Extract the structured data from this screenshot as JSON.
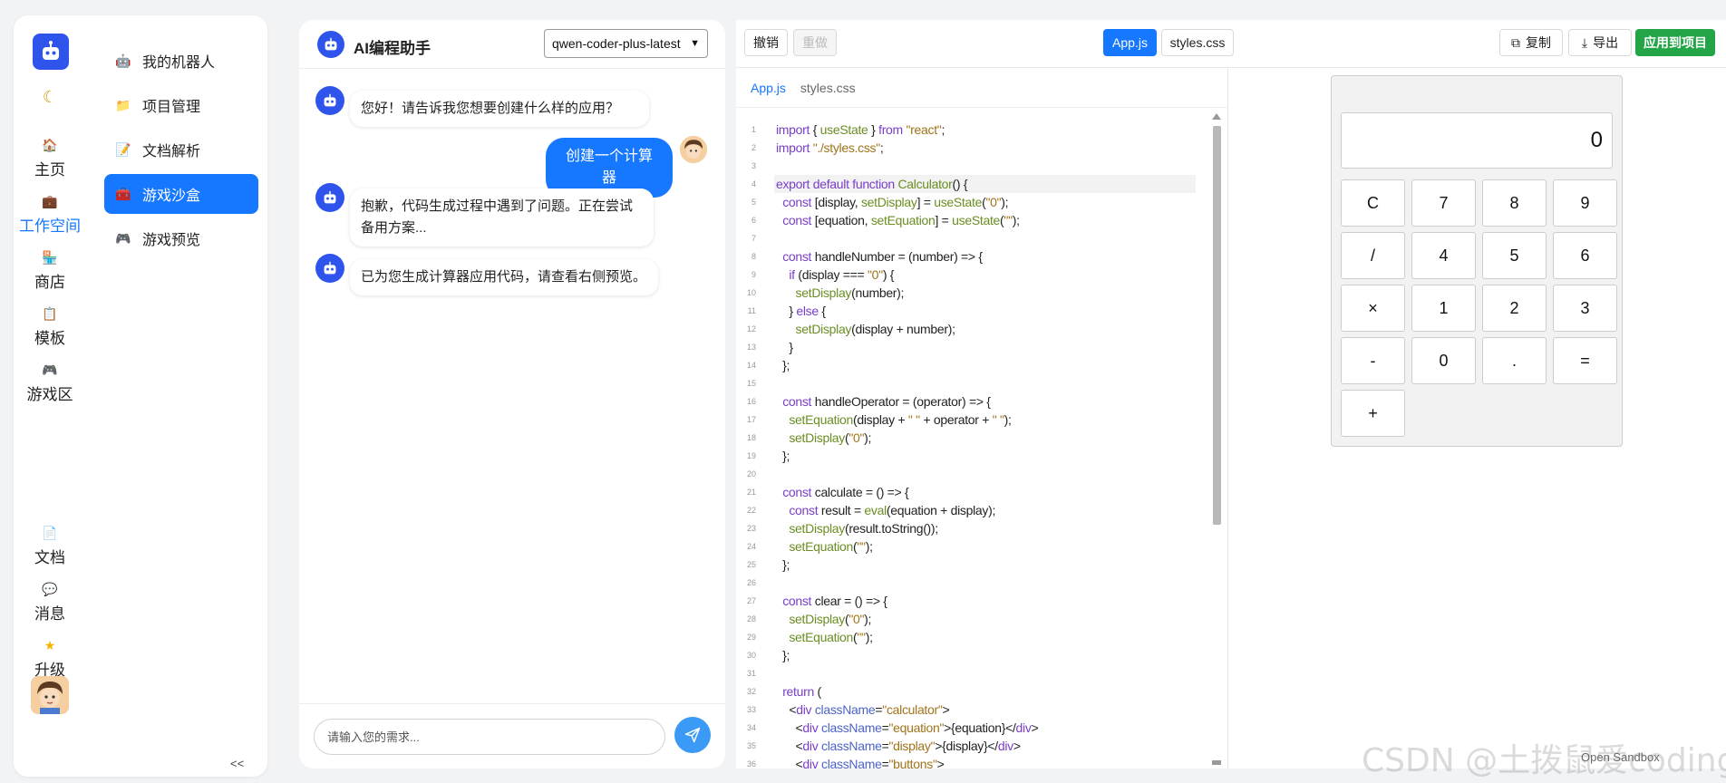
{
  "sidebar": {
    "rail": {
      "items": [
        {
          "label": "主页",
          "icon": "home-icon"
        },
        {
          "label": "工作空间",
          "icon": "briefcase-icon",
          "active": true
        },
        {
          "label": "商店",
          "icon": "store-icon"
        },
        {
          "label": "模板",
          "icon": "clipboard-icon"
        },
        {
          "label": "游戏区",
          "icon": "gamepad-icon"
        }
      ],
      "bottom_items": [
        {
          "label": "文档",
          "icon": "document-icon"
        },
        {
          "label": "消息",
          "icon": "chat-bubble-icon"
        },
        {
          "label": "升级",
          "icon": "star-icon"
        }
      ]
    },
    "nav": {
      "items": [
        {
          "label": "我的机器人",
          "icon": "robot-icon"
        },
        {
          "label": "项目管理",
          "icon": "folder-icon"
        },
        {
          "label": "文档解析",
          "icon": "edit-document-icon"
        },
        {
          "label": "游戏沙盒",
          "icon": "toolbox-icon",
          "active": true
        },
        {
          "label": "游戏预览",
          "icon": "gamepad-icon"
        }
      ]
    },
    "collapse_label": "<<"
  },
  "chat": {
    "title": "AI编程助手",
    "model": "qwen-coder-plus-latest",
    "messages": [
      {
        "role": "bot",
        "text": "您好！请告诉我您想要创建什么样的应用？"
      },
      {
        "role": "user",
        "text": "创建一个计算器"
      },
      {
        "role": "bot",
        "text": "抱歉，代码生成过程中遇到了问题。正在尝试备用方案..."
      },
      {
        "role": "bot",
        "text": "已为您生成计算器应用代码，请查看右侧预览。"
      }
    ],
    "input_placeholder": "请输入您的需求..."
  },
  "toolbar": {
    "undo_label": "撤销",
    "redo_label": "重做",
    "tabs": [
      "App.js",
      "styles.css"
    ],
    "active_tab": "App.js",
    "copy_label": "复制",
    "export_label": "导出",
    "apply_label": "应用到项目"
  },
  "editor": {
    "tabs": [
      "App.js",
      "styles.css"
    ],
    "lines": [
      {
        "n": 1,
        "text": "import { useState } from \"react\";"
      },
      {
        "n": 2,
        "text": "import \"./styles.css\";"
      },
      {
        "n": 3,
        "text": ""
      },
      {
        "n": 4,
        "text": "export default function Calculator() {"
      },
      {
        "n": 5,
        "text": "  const [display, setDisplay] = useState(\"0\");"
      },
      {
        "n": 6,
        "text": "  const [equation, setEquation] = useState(\"\");"
      },
      {
        "n": 7,
        "text": ""
      },
      {
        "n": 8,
        "text": "  const handleNumber = (number) => {"
      },
      {
        "n": 9,
        "text": "    if (display === \"0\") {"
      },
      {
        "n": 10,
        "text": "      setDisplay(number);"
      },
      {
        "n": 11,
        "text": "    } else {"
      },
      {
        "n": 12,
        "text": "      setDisplay(display + number);"
      },
      {
        "n": 13,
        "text": "    }"
      },
      {
        "n": 14,
        "text": "  };"
      },
      {
        "n": 15,
        "text": ""
      },
      {
        "n": 16,
        "text": "  const handleOperator = (operator) => {"
      },
      {
        "n": 17,
        "text": "    setEquation(display + \" \" + operator + \" \");"
      },
      {
        "n": 18,
        "text": "    setDisplay(\"0\");"
      },
      {
        "n": 19,
        "text": "  };"
      },
      {
        "n": 20,
        "text": ""
      },
      {
        "n": 21,
        "text": "  const calculate = () => {"
      },
      {
        "n": 22,
        "text": "    const result = eval(equation + display);"
      },
      {
        "n": 23,
        "text": "    setDisplay(result.toString());"
      },
      {
        "n": 24,
        "text": "    setEquation(\"\");"
      },
      {
        "n": 25,
        "text": "  };"
      },
      {
        "n": 26,
        "text": ""
      },
      {
        "n": 27,
        "text": "  const clear = () => {"
      },
      {
        "n": 28,
        "text": "    setDisplay(\"0\");"
      },
      {
        "n": 29,
        "text": "    setEquation(\"\");"
      },
      {
        "n": 30,
        "text": "  };"
      },
      {
        "n": 31,
        "text": ""
      },
      {
        "n": 32,
        "text": "  return ("
      },
      {
        "n": 33,
        "text": "    <div className=\"calculator\">"
      },
      {
        "n": 34,
        "text": "      <div className=\"equation\">{equation}</div>"
      },
      {
        "n": 35,
        "text": "      <div className=\"display\">{display}</div>"
      },
      {
        "n": 36,
        "text": "      <div className=\"buttons\">"
      }
    ]
  },
  "preview": {
    "display": "0",
    "equation": "",
    "keys": [
      "C",
      "7",
      "8",
      "9",
      "/",
      "4",
      "5",
      "6",
      "×",
      "1",
      "2",
      "3",
      "-",
      "0",
      ".",
      "=",
      "+"
    ]
  },
  "watermark": "CSDN @土拨鼠爱coding",
  "sandbox_label": "Open Sandbox",
  "colors": {
    "accent": "#1677ff",
    "apply_green": "#22a447",
    "logo_blue": "#2f54eb"
  }
}
